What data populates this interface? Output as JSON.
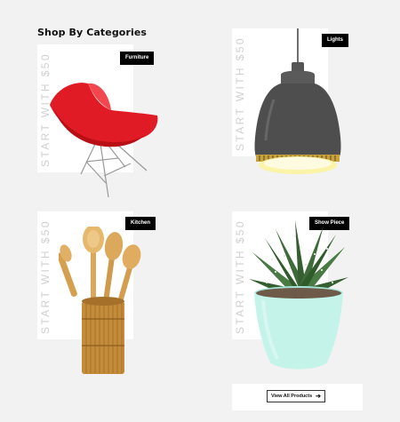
{
  "section": {
    "title": "Shop By Categories"
  },
  "categories": [
    {
      "label": "Furniture",
      "promo": "START WITH $50",
      "icon": "red-chair-image"
    },
    {
      "label": "Lights",
      "promo": "START WITH $50",
      "icon": "pendant-lamp-image"
    },
    {
      "label": "Kitchen",
      "promo": "START WITH $50",
      "icon": "wooden-utensils-image"
    },
    {
      "label": "Show Piece",
      "promo": "START WITH $50",
      "icon": "potted-succulent-image"
    }
  ],
  "cta": {
    "label": "View All Products",
    "icon": "arrow-right-icon"
  },
  "colors": {
    "badge_bg": "#000000",
    "promo_text": "#cfcfcf",
    "chair": "#e0202a",
    "lamp": "#4a4a4a",
    "pot": "#bff2e8"
  }
}
